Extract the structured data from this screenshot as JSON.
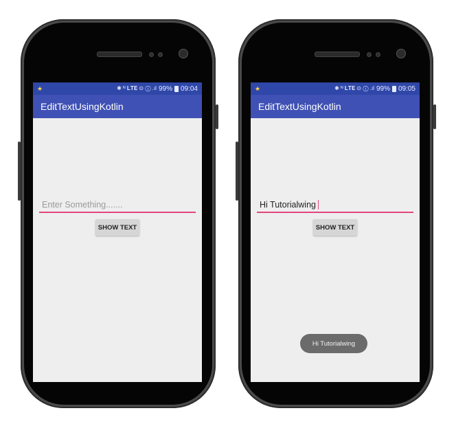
{
  "phone_left": {
    "status": {
      "indicators": "✱ ᴺ 𝐋𝐓𝐄 ⊙ ⓘ .ıl",
      "battery": "99%",
      "time": "09:04"
    },
    "app_title": "EditTextUsingKotlin",
    "edit_text": {
      "placeholder": "Enter Something.......",
      "value": ""
    },
    "button_label": "SHOW TEXT"
  },
  "phone_right": {
    "status": {
      "indicators": "✱ ᴺ 𝐋𝐓𝐄 ⊙ ⓘ .ıl",
      "battery": "99%",
      "time": "09:05"
    },
    "app_title": "EditTextUsingKotlin",
    "edit_text": {
      "placeholder": "Enter Something.......",
      "value": "Hi Tutorialwing"
    },
    "button_label": "SHOW TEXT",
    "toast": "Hi Tutorialwing"
  },
  "colors": {
    "status_bar": "#2f47a8",
    "app_bar": "#3f51b5",
    "accent": "#e2467e",
    "screen_bg": "#eeeeee"
  }
}
